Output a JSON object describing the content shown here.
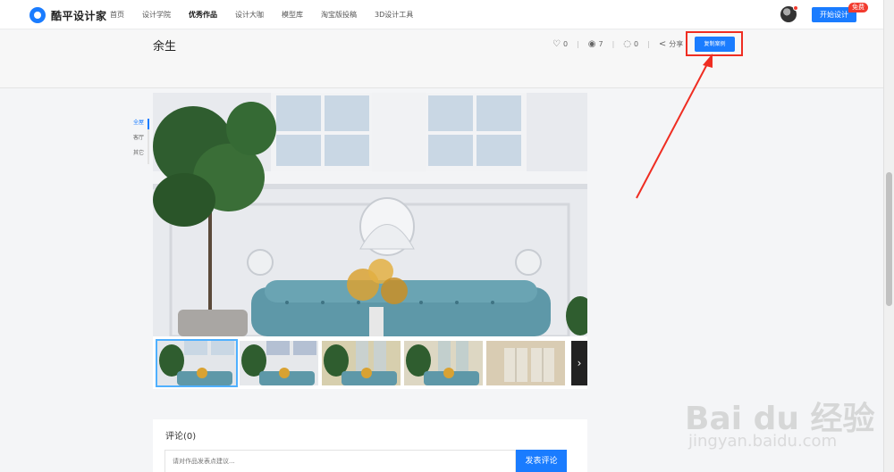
{
  "nav": {
    "logo_text": "酷平设计家",
    "items": [
      {
        "label": "首页",
        "active": false
      },
      {
        "label": "设计学院",
        "active": false
      },
      {
        "label": "优秀作品",
        "active": true
      },
      {
        "label": "设计大咖",
        "active": false
      },
      {
        "label": "模型库",
        "active": false
      },
      {
        "label": "淘宝版投稿",
        "active": false
      },
      {
        "label": "3D设计工具",
        "active": false
      }
    ],
    "start_button": "开始设计",
    "free_badge": "免费"
  },
  "work": {
    "title": "余生",
    "likes": "0",
    "views": "7",
    "comments": "0",
    "share_label": "分享",
    "copy_button": "复制案例"
  },
  "filters": [
    {
      "label": "全屋",
      "active": true
    },
    {
      "label": "客厅",
      "active": false
    },
    {
      "label": "其它",
      "active": false
    }
  ],
  "gallery": {
    "next_icon": "chevron-right-icon"
  },
  "comments_section": {
    "title": "评论(0)",
    "input_placeholder": "请对作品发表点建议...",
    "post_button": "发表评论"
  },
  "watermark": {
    "big": "Bai du 经验",
    "small": "jingyan.baidu.com"
  },
  "colors": {
    "accent": "#1a7cff",
    "annotation_red": "#ef2d22",
    "badge_red": "#f23b2f"
  }
}
